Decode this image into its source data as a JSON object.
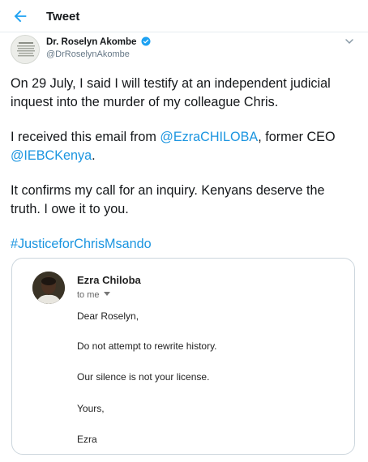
{
  "header": {
    "title": "Tweet",
    "back_icon": "arrow-left-icon"
  },
  "tweet": {
    "author_name": "Dr. Roselyn Akombe",
    "handle": "@DrRoselynAkombe",
    "verified": true,
    "more_icon": "chevron-down-icon",
    "line1": "On 29 July, I said I will testify at an independent judicial",
    "line2": "inquest into the murder of my colleague Chris.",
    "line3_pre": "I received this email from ",
    "mention1": "@EzraCHILOBA",
    "line3_post": ", former CEO",
    "mention2": "@IEBCKenya",
    "line4_post": ".",
    "line5": "It confirms my call for an inquiry.  Kenyans deserve the",
    "line6": "truth. I owe it to you.",
    "hashtag": "#JusticeforChrisMsando"
  },
  "email": {
    "sender": "Ezra Chiloba",
    "recipient": "to me",
    "greeting": "Dear Roselyn,",
    "body1": "Do not attempt to rewrite history.",
    "body2": "Our silence is not your license.",
    "closing": "Yours,",
    "signature": "Ezra"
  },
  "colors": {
    "link": "#1b95e0",
    "verified": "#1da1f2",
    "border": "#ccd6dd"
  }
}
